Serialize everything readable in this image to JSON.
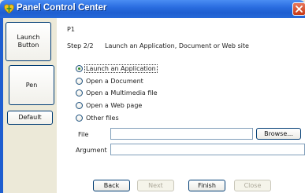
{
  "window": {
    "title": "Panel Control Center",
    "icon": "heart-shield-icon",
    "close_icon": "close-icon"
  },
  "sidebar": {
    "buttons": [
      {
        "label": "Launch\nButton"
      },
      {
        "label": "Pen"
      },
      {
        "label": "Default"
      }
    ]
  },
  "main": {
    "panel_id": "P1",
    "step": "Step 2/2",
    "instruction": "Launch an Application, Document or Web site",
    "options": [
      {
        "label": "Launch an Application",
        "selected": true
      },
      {
        "label": "Open a Document",
        "selected": false
      },
      {
        "label": "Open a Multimedia file",
        "selected": false
      },
      {
        "label": "Open a Web page",
        "selected": false
      },
      {
        "label": "Other files",
        "selected": false
      }
    ],
    "file_label": "File",
    "file_value": "",
    "browse_label": "Browse...",
    "argument_label": "Argument",
    "argument_value": ""
  },
  "footer": {
    "back": "Back",
    "next": "Next",
    "finish": "Finish",
    "close": "Close"
  },
  "colors": {
    "titlebar": "#2a6de0",
    "accent_border": "#003c74",
    "selected_radio": "#2b8a2b"
  }
}
